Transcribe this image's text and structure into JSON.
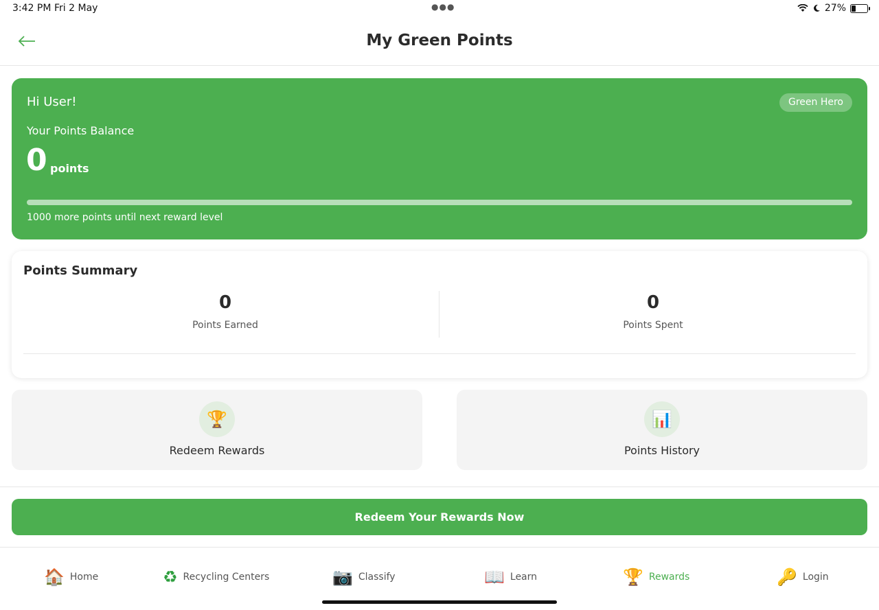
{
  "status_bar": {
    "time": "3:42 PM",
    "date": "Fri 2 May",
    "battery_percent": "27%",
    "battery_level": 0.27
  },
  "header": {
    "title": "My Green Points",
    "back_icon": "arrow-left-icon"
  },
  "balance_card": {
    "greeting": "Hi User!",
    "level_badge": "Green Hero",
    "balance_label": "Your Points Balance",
    "balance_value": "0",
    "balance_unit": "points",
    "progress_fraction": 0,
    "progress_text": "1000 more points until next reward level"
  },
  "summary": {
    "title": "Points Summary",
    "earned_value": "0",
    "earned_label": "Points Earned",
    "spent_value": "0",
    "spent_label": "Points Spent"
  },
  "actions": [
    {
      "label": "Redeem Rewards",
      "icon": "trophy-icon"
    },
    {
      "label": "Points History",
      "icon": "bar-chart-icon"
    }
  ],
  "cta": {
    "label": "Redeem Your Rewards Now"
  },
  "nav": [
    {
      "label": "Home",
      "icon": "house-icon",
      "active": false
    },
    {
      "label": "Recycling Centers",
      "icon": "recycle-icon",
      "active": false
    },
    {
      "label": "Classify",
      "icon": "camera-icon",
      "active": false
    },
    {
      "label": "Learn",
      "icon": "book-icon",
      "active": false
    },
    {
      "label": "Rewards",
      "icon": "trophy-icon",
      "active": true
    },
    {
      "label": "Login",
      "icon": "key-icon",
      "active": false
    }
  ],
  "colors": {
    "primary_green": "#4caf50",
    "tile_background": "#f4f4f4",
    "icon_circle": "#e2eee0"
  }
}
